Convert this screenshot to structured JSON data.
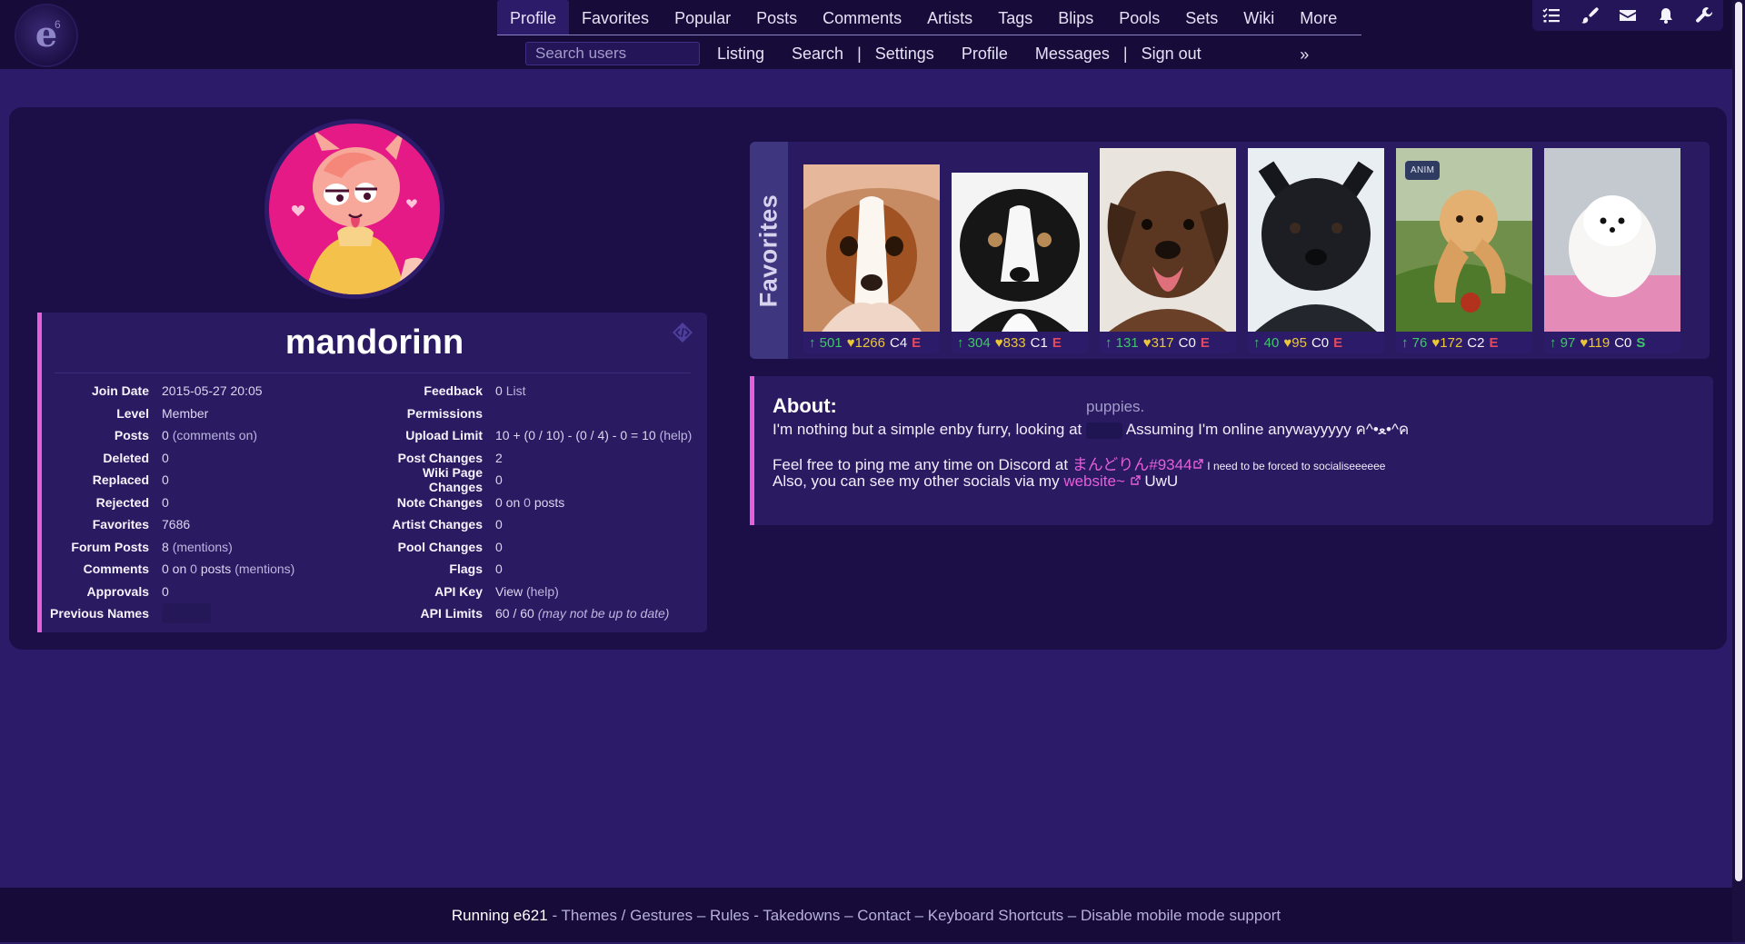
{
  "nav": {
    "logo": "e",
    "logo_sup": "6",
    "main_tabs": [
      "Profile",
      "Favorites",
      "Popular",
      "Posts",
      "Comments",
      "Artists",
      "Tags",
      "Blips",
      "Pools",
      "Sets",
      "Wiki",
      "More »"
    ],
    "search_placeholder": "Search users",
    "sub_links": [
      "Listing",
      "Search",
      "|",
      "Settings",
      "Profile",
      "Messages",
      "|",
      "Sign out"
    ]
  },
  "profile": {
    "username": "mandorinn",
    "left": [
      {
        "label": "Join Date",
        "value": "2015-05-27 20:05"
      },
      {
        "label": "Level",
        "value": "Member"
      },
      {
        "label": "Posts",
        "value": "0",
        "extra": "(comments on)"
      },
      {
        "label": "Deleted",
        "value": "0"
      },
      {
        "label": "Replaced",
        "value": "0"
      },
      {
        "label": "Rejected",
        "value": "0"
      },
      {
        "label": "Favorites",
        "value": "7686"
      },
      {
        "label": "Forum Posts",
        "value": "8",
        "extra": "(mentions)"
      },
      {
        "label": "Comments",
        "value": "0 on",
        "extra": "0",
        "extra2": "posts",
        "extra3": "(mentions)"
      },
      {
        "label": "Approvals",
        "value": "0"
      },
      {
        "label": "Previous Names",
        "value": ""
      }
    ],
    "right": [
      {
        "label": "Feedback",
        "value": "0",
        "extra": "List"
      },
      {
        "label": "Permissions",
        "value": ""
      },
      {
        "label": "Upload Limit",
        "value": "10 + (0 / 10) - (0 / 4) - 0 = 10",
        "extra": "(help)"
      },
      {
        "label": "Post Changes",
        "value": "2"
      },
      {
        "label": "Wiki Page Changes",
        "value": "0"
      },
      {
        "label": "Note Changes",
        "value": "0 on",
        "extra": "0",
        "extra2": "posts"
      },
      {
        "label": "Artist Changes",
        "value": "0"
      },
      {
        "label": "Pool Changes",
        "value": "0"
      },
      {
        "label": "Flags",
        "value": "0"
      },
      {
        "label": "API Key",
        "value": "View",
        "extra": "(help)"
      },
      {
        "label": "API Limits",
        "value": "60 / 60",
        "extra": "(may not be up to date)"
      }
    ]
  },
  "favorites": {
    "title": "Favorites",
    "items": [
      {
        "up": "501",
        "favs": "1266",
        "comments": "C4",
        "rating": "E"
      },
      {
        "up": "304",
        "favs": "833",
        "comments": "C1",
        "rating": "E"
      },
      {
        "up": "131",
        "favs": "317",
        "comments": "C0",
        "rating": "E"
      },
      {
        "up": "40",
        "favs": "95",
        "comments": "C0",
        "rating": "E"
      },
      {
        "up": "76",
        "favs": "172",
        "comments": "C2",
        "rating": "E",
        "badge": "ANIM"
      },
      {
        "up": "97",
        "favs": "119",
        "comments": "C0",
        "rating": "S"
      }
    ]
  },
  "about": {
    "title": "About:",
    "ghost": "puppies.",
    "line1a": "I'm nothing but a simple enby furry, looking at",
    "line1b": "Assuming I'm online anywayyyyy ค^•ﻌ•^ค",
    "line2a": "Feel free to ping me any time on Discord at",
    "discord": "まんどりん#9344",
    "line2b": "I need to be forced to socialiseeeeee",
    "line3a": "Also, you can see my other socials via my",
    "website": "website~",
    "line3b": "UwU"
  },
  "footer": {
    "running": "Running e621",
    "parts": [
      " - ",
      "Themes",
      " / ",
      "Gestures",
      " – ",
      "Rules",
      " - ",
      "Takedowns",
      " – ",
      "Contact",
      " – ",
      "Keyboard Shortcuts",
      " – ",
      "Disable mobile mode support"
    ]
  },
  "colors": {
    "accent": "#e45fd8",
    "bg": "#2c1b68",
    "panel": "#2a1a62",
    "nav": "#170b3a"
  }
}
